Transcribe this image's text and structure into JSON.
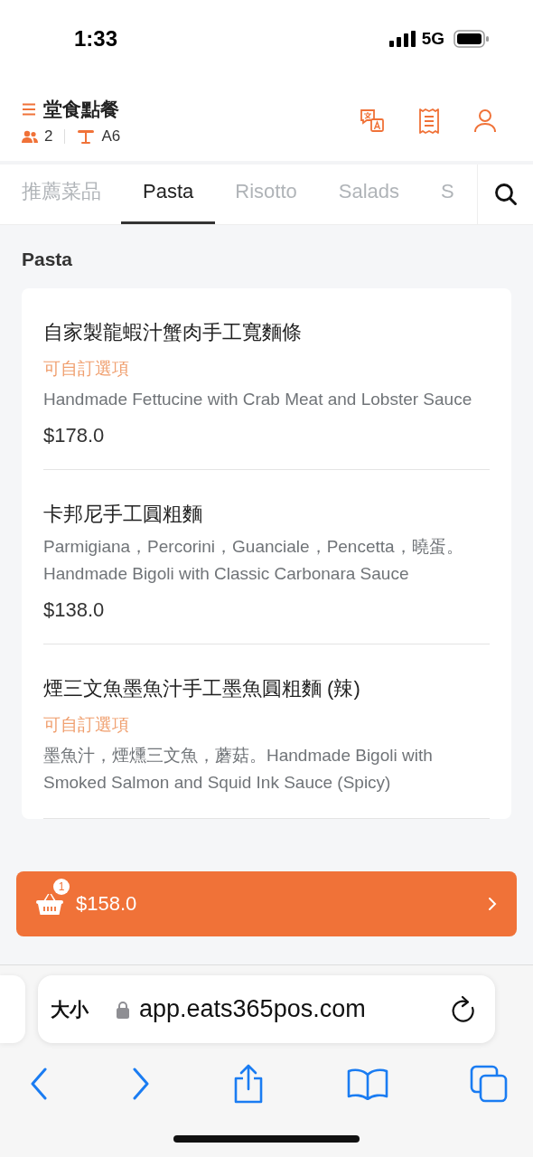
{
  "status_bar": {
    "time": "1:33",
    "network": "5G"
  },
  "header": {
    "title": "堂食點餐",
    "guests": "2",
    "table": "A6"
  },
  "tabs": [
    {
      "label": "推薦菜品",
      "selected": false
    },
    {
      "label": "Pasta",
      "selected": true
    },
    {
      "label": "Risotto",
      "selected": false
    },
    {
      "label": "Salads",
      "selected": false
    },
    {
      "label": "S",
      "selected": false
    }
  ],
  "section": {
    "title": "Pasta"
  },
  "items": [
    {
      "name": "自家製龍蝦汁蟹肉手工寬麵條",
      "option": "可自訂選項",
      "description": "Handmade Fettucine with Crab Meat and Lobster Sauce",
      "price": "$178.0"
    },
    {
      "name": "卡邦尼手工圓粗麵",
      "description": "Parmigiana，Percorini，Guanciale，Pencetta，曉蛋。    Handmade Bigoli with Classic Carbonara Sauce",
      "price": "$138.0"
    },
    {
      "name": "煙三文魚墨魚汁手工墨魚圓粗麵 (辣)",
      "option": "可自訂選項",
      "description": "墨魚汁，煙燻三文魚，蘑菇。Handmade Bigoli with Smoked Salmon and Squid Ink Sauce (Spicy)"
    }
  ],
  "cart": {
    "count": "1",
    "total": "$158.0"
  },
  "browser": {
    "text_size": "大小",
    "url": "app.eats365pos.com"
  }
}
